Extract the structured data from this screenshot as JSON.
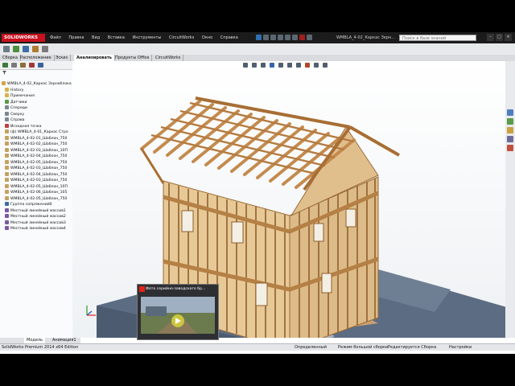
{
  "app": {
    "logo_text": "SOLIDWORKS",
    "menus": [
      "Файл",
      "Правка",
      "Вид",
      "Вставка",
      "Инструменты",
      "CircuitWorks",
      "Окно",
      "Справка"
    ],
    "document_title": "WMBLA_4-02_Каркас Зерн...",
    "search_placeholder": "Поиск в базе знаний",
    "window_buttons": [
      "–",
      "□",
      "×"
    ]
  },
  "command_tabs": [
    "Сборка",
    "Расположение",
    "Эскиз",
    "Анализировать",
    "Продукты Office",
    "CircuitWorks"
  ],
  "active_tab": "Анализировать",
  "feature_tree": {
    "root": "WMBLA_4-02_Каркас Зерноблока",
    "items": [
      {
        "label": "History",
        "icon": "folder-icon"
      },
      {
        "label": "Примечания",
        "icon": "folder-icon"
      },
      {
        "label": "Датчики",
        "icon": "sensor-icon"
      },
      {
        "label": "Спереди",
        "icon": "plane-icon"
      },
      {
        "label": "Сверху",
        "icon": "plane-icon"
      },
      {
        "label": "Справа",
        "icon": "plane-icon"
      },
      {
        "label": "Исходная точка",
        "icon": "origin-icon"
      },
      {
        "label": "(ф) WMBLA_4-01_Каркас Стро",
        "icon": "part-icon"
      },
      {
        "label": "WMBLA_4-02-01_Шаблон_750",
        "icon": "part-icon"
      },
      {
        "label": "WMBLA_4-02-02_Шаблон_750",
        "icon": "part-icon"
      },
      {
        "label": "WMBLA_4-02-03_Шаблон_10П",
        "icon": "part-icon"
      },
      {
        "label": "WMBLA_4-02-04_Шаблон_750",
        "icon": "part-icon"
      },
      {
        "label": "WMBLA_4-02-05_Шаблон_750",
        "icon": "part-icon"
      },
      {
        "label": "WMBLA_4-02-03_Шаблон_750",
        "icon": "part-icon"
      },
      {
        "label": "WMBLA_4-02-04_Шаблон_750",
        "icon": "part-icon"
      },
      {
        "label": "WMBLA_4-02-03_Шаблон_750",
        "icon": "part-icon"
      },
      {
        "label": "WMBLA_4-02-05_Шаблон_10П",
        "icon": "part-icon"
      },
      {
        "label": "WMBLA_4-02-06_Шаблон_105",
        "icon": "part-icon"
      },
      {
        "label": "WMBLA_4-02-05_Шаблон_750",
        "icon": "part-icon"
      },
      {
        "label": "Группа сопряжений0",
        "icon": "mates-icon"
      },
      {
        "label": "Местный линейный массив1",
        "icon": "pattern-icon"
      },
      {
        "label": "Местный линейный массив2",
        "icon": "pattern-icon"
      },
      {
        "label": "Местный линейный массив3",
        "icon": "pattern-icon"
      },
      {
        "label": "Местный линейный массив4",
        "icon": "pattern-icon"
      }
    ]
  },
  "bottom_tabs": [
    "Модель",
    "Анимация1"
  ],
  "status": {
    "edition": "SolidWorks Premium 2014 x64 Edition",
    "state": "Определенный",
    "mode": "Режим большой сборки",
    "editing": "Редактируется Сборка",
    "settings": "Настройки"
  },
  "video": {
    "title": "Фото серийно-заводского бр...",
    "icon": "youtube-icon"
  },
  "colors": {
    "accent_red": "#c8101f",
    "wood": "#d9ad75",
    "slab": "#5d6e84"
  }
}
